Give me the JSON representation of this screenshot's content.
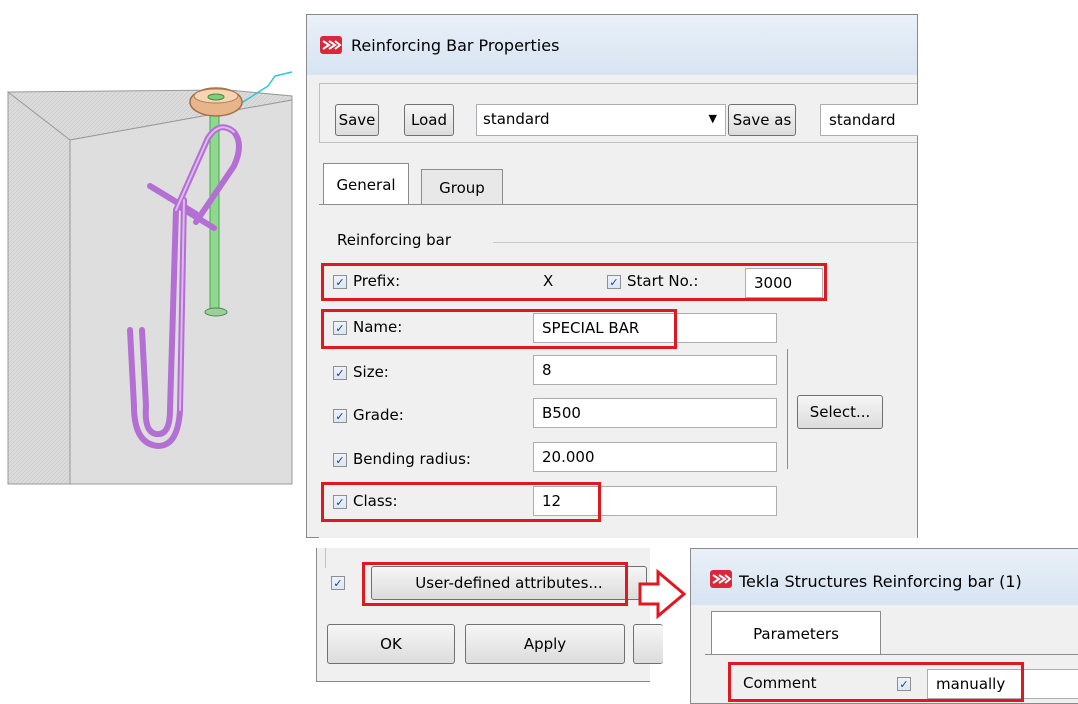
{
  "dialog": {
    "title": "Reinforcing Bar Properties",
    "toolbar": {
      "save_label": "Save",
      "load_label": "Load",
      "preset_value": "standard",
      "save_as_label": "Save as",
      "save_as_value": "standard"
    },
    "tabs": [
      {
        "label": "General"
      },
      {
        "label": "Group"
      }
    ],
    "section_title": "Reinforcing bar",
    "fields": {
      "prefix": {
        "label": "Prefix:",
        "value": "X",
        "checked": true
      },
      "start_no": {
        "label": "Start No.:",
        "value": "3000",
        "checked": true
      },
      "name": {
        "label": "Name:",
        "value": "SPECIAL BAR",
        "checked": true
      },
      "size": {
        "label": "Size:",
        "value": "8",
        "checked": true
      },
      "grade": {
        "label": "Grade:",
        "value": "B500",
        "checked": true
      },
      "bending_radius": {
        "label": "Bending radius:",
        "value": "20.000",
        "checked": true
      },
      "class": {
        "label": "Class:",
        "value": "12",
        "checked": true
      }
    },
    "select_label": "Select...",
    "uda_label": "User-defined attributes...",
    "ok_label": "OK",
    "apply_label": "Apply"
  },
  "uda_dialog": {
    "title": "Tekla Structures  Reinforcing bar (1)",
    "tab_label": "Parameters",
    "comment_label": "Comment",
    "comment_value": "manually"
  },
  "colors": {
    "highlight": "#e0181f",
    "rebar": "#c77ee0",
    "selected_bar": "#7fd07f"
  }
}
